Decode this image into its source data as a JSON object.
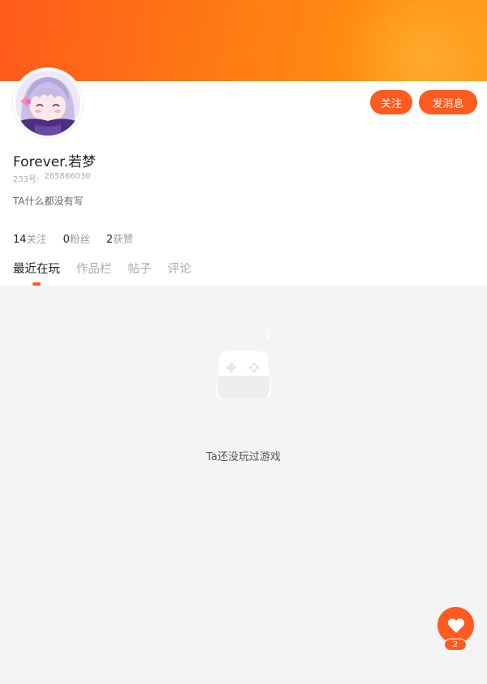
{
  "profile": {
    "username": "Forever.若梦",
    "id_label": "233号:",
    "id_value": "265866030",
    "bio": "TA什么都没有写"
  },
  "actions": {
    "follow_label": "关注",
    "message_label": "发消息"
  },
  "stats": [
    {
      "count": "14",
      "label": "关注"
    },
    {
      "count": "0",
      "label": "粉丝"
    },
    {
      "count": "2",
      "label": "获赞"
    }
  ],
  "tabs": [
    {
      "label": "最近在玩",
      "active": true
    },
    {
      "label": "作品栏",
      "active": false
    },
    {
      "label": "帖子",
      "active": false
    },
    {
      "label": "评论",
      "active": false
    }
  ],
  "empty_state": {
    "icon": "gamepad-icon",
    "message": "Ta还没玩过游戏"
  },
  "like": {
    "icon": "heart-icon",
    "count": "2"
  },
  "colors": {
    "accent": "#ff5a1f",
    "banner_start": "#ff5a1a",
    "banner_end": "#ff9a1e",
    "background": "#f4f4f4"
  }
}
